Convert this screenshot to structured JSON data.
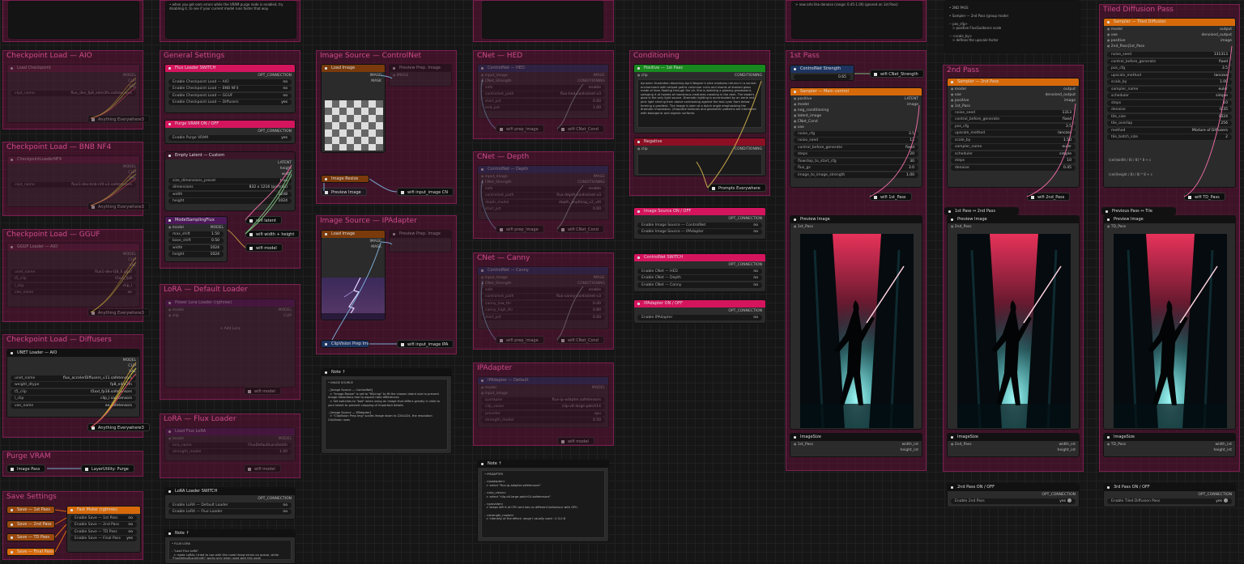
{
  "groups": {
    "ckpt_aio": "Checkpoint Load — AIO",
    "ckpt_nf4": "Checkpoint Load — BNB NF4",
    "ckpt_gguf": "Checkpoint Load — GGUF",
    "ckpt_diff": "Checkpoint Load — Diffusers",
    "purge": "Purge VRAM",
    "save": "Save Settings",
    "general": "General Settings",
    "lora_def": "LoRA — Default Loader",
    "lora_flux": "LoRA — Flux Loader",
    "img_cn": "Image Source — ControlNet",
    "img_ipa": "Image Source — IPAdapter",
    "cnet_hed": "CNet — HED",
    "cnet_depth": "CNet — Depth",
    "cnet_canny": "CNet — Canny",
    "ipadapter": "IPAdapter",
    "conditioning": "Conditioning",
    "pass1": "1st Pass",
    "pass2": "2nd Pass",
    "tiled": "Tiled Diffusion Pass"
  },
  "nodes": {
    "load_ckpt": "Load Checkpoint",
    "ckpt_nf4": "CheckpointLoaderNF4",
    "gguf_loader": "GGUF Loader — AIO",
    "unet_loader": "UNET Loader — AIO",
    "image_pass": "Image Pass",
    "layerutility_purge": "LayerUtility: Purge",
    "save_1st": "Save — 1st Pass",
    "save_2nd": "Save — 2nd Pass",
    "save_td": "Save — TD Pass",
    "save_final": "Save — Final Pass",
    "fast_muter": "Fast Muter (rgthree)",
    "flux_loader_switch": "Flux Loader SWITCH",
    "purge_switch": "Purge VRAM ON / OFF",
    "empty_latent": "Empty Latent — Custom",
    "model_sampling": "ModelSamplingFlux",
    "power_lora": "Power Lora Loader (rgthree)",
    "load_flux_lora": "Load Flux LoRA",
    "lora_switch": "LoRA Loader SWITCH",
    "note": "Note ↑",
    "load_image": "Load Image",
    "preview_prep": "Preview Prep. Image",
    "image_resize": "Image Resize",
    "clipvision_prep": "ClipVision Prep Img.",
    "controlnet_hed": "ControlNet — HED",
    "controlnet_depth": "ControlNet — Depth",
    "controlnet_canny": "ControlNet — Canny",
    "ipadapter_default": "IPAdapter — Default",
    "positive_1st": "Positive — 1st Pass",
    "negative": "Negative",
    "img_src_switch": "Image Source ON / OFF",
    "controlnet_switch": "ControlNet SWITCH",
    "ipadapter_switch": "IPAdapter ON / OFF",
    "controlnet_strength": "ControlNet Strength",
    "sampler_main": "Sampler — Main control",
    "preview_image": "Preview Image",
    "image_size": "ImageSize",
    "sampler_2nd": "Sampler — 2nd Pass",
    "pass2_switch": "2nd Pass  ON / OFF",
    "prev_tile": "Previous Pass ↔ Tile",
    "sampler_tiled": "Sampler — Tiled Diffusion",
    "pass3_switch": "3rd Pass  ON / OFF",
    "pass_1_2": "1st Pass ↔ 2nd Pass"
  },
  "labels": {
    "anything_everywhere3": "Anything Everywhere3",
    "anything_everywhere": "Anything Everywhere",
    "model": "MODEL",
    "clip": "CLIP",
    "vae": "VAE",
    "opt_connection": "OPT_CONNECTION",
    "conditioning": "CONDITIONING",
    "latent": "LATENT",
    "width": "width",
    "height": "height",
    "wifi_latent": "wifi latent",
    "wifi_wh": "wifi width + height",
    "wifi_model": "wifi model",
    "wifi_prep_image": "wifi prep_image",
    "wifi_cnet_cond": "wifi CNet_Cond",
    "wifi_input_cn": "wifi input_image CN",
    "wifi_input_ipa": "wifi input_image IPA",
    "prompts_everywhere": "Prompts Everywhere",
    "wifi_cnet_strength": "wifi CNet_Strength",
    "wifi_1st": "wifi 1st_Pass",
    "wifi_2nd": "wifi 2nd_Pass",
    "wifi_td": "wifi TD_Pass",
    "pass1": "1st_Pass",
    "pass2": "2nd_Pass",
    "td_pass": "TD_Pass",
    "width_int": "width_int",
    "height_int": "height_int",
    "image": "image",
    "images": "IMAGE",
    "image_in": "image",
    "clip_in": "clip",
    "model_in": "model",
    "positive": "positive",
    "negative": "negative",
    "vae_in": "vae",
    "denoised_output": "denoised_output",
    "output": "output",
    "image_out": "IMAGE",
    "mask": "MASK",
    "clip_vision": "CLIP_VISION",
    "preview_image_link": "Preview Image",
    "cnet_strength": "CNet_Strength",
    "input_image": "input_image",
    "neg_cond": "neg_conditioning",
    "latent_image": "latent_image",
    "cnet_cond": "CNet_Cond"
  },
  "widgets": {
    "ckpt_name": "flux_dev_fp8_e4m3fn.safetensors",
    "unet_name": "flux_dev_fp8_e4m3fn.safetensors",
    "bnb_name": "flux1-dev-bnb-nf4-v2.safetensors",
    "gguf_name": "flux1-dev-Q8_0.gguf",
    "enable_aio": "Enable Checkpoint Load — AIO",
    "enable_nf4": "Enable Checkpoint Load — BNB NF4",
    "enable_gguf": "Enable Checkpoint Load — GGUF",
    "enable_diff": "Enable Checkpoint Load — Diffusers",
    "enable_purge": "Enable Purge VRAM",
    "size_preset": "size_dimensions_preset",
    "size_val": "832 x 1216 (portrait)",
    "dimensions": "dimensions",
    "w": "1248",
    "h": "1024",
    "max_shift": "max_shift",
    "max_shift_v": "1.50",
    "base_shift": "base_shift",
    "base_shift_v": "0.50",
    "width": "width",
    "width_v": "1024",
    "height": "height",
    "height_v": "1024",
    "no": "no",
    "yes": "yes",
    "true": "true",
    "unet_name_l": "unet_name",
    "unet_val": "flux_accelerDiffusers_v11.safetensors",
    "weight_dtype": "weight_dtype",
    "weight_val": "fp8_e4m3fn",
    "clip1": "t5_clip",
    "clip1_v": "t5xxl_fp16.safetensors",
    "clip2": "l_clip",
    "clip2_v": "clip_l.safetensors",
    "vae_name": "vae_name",
    "vae_v": "ae.safetensors",
    "enable_save_1st": "Enable Save — 1st Pass",
    "enable_save_2nd": "Enable Save — 2nd Pass",
    "enable_save_td": "Enable Save — TD Pass",
    "enable_save_final": "Enable Save — Final Pass",
    "enable_default_loader": "Enable LoRA — Default Loader",
    "enable_flux_loader": "Enable LoRA — Flux Loader",
    "enable_is_cn": "Enable Image Source — ControlNet",
    "enable_is_ipa": "Enable Image Source — IPAdapter",
    "enable_hed": "Enable CNet — HED",
    "enable_depth": "Enable CNet — Depth",
    "enable_canny": "Enable CNet — Canny",
    "enable_ipa": "Enable IPAdapter",
    "enable_2nd": "Enable 2nd Pass",
    "enable_tiled": "Enable Tiled Diffusion Pass",
    "strength_v": "0.65",
    "add_lora": "+ Add Lora"
  },
  "sampler1": [
    [
      "noise_cfg",
      "3.5"
    ],
    [
      "noise_seed",
      "12"
    ],
    [
      "control_before_generate",
      "fixed"
    ],
    [
      "steps",
      "20"
    ],
    [
      "flowstep_to_start_cfg",
      "30"
    ],
    [
      "flux_gs",
      "3.0"
    ],
    [
      "image_to_image_strength",
      "1.00"
    ]
  ],
  "sampler2": [
    [
      "noise_seed",
      "1313"
    ],
    [
      "control_before_generate",
      "fixed"
    ],
    [
      "pos_cfg",
      "3.5"
    ],
    [
      "upscale_method",
      "lanczos"
    ],
    [
      "scale_by",
      "1.50"
    ],
    [
      "sampler_name",
      "euler"
    ],
    [
      "scheduler",
      "simple"
    ],
    [
      "steps",
      "10"
    ],
    [
      "denoise",
      "0.45"
    ]
  ],
  "sampler3": [
    [
      "noise_seed",
      "131313"
    ],
    [
      "control_before_generate",
      "fixed"
    ],
    [
      "pos_cfg",
      "3.5"
    ],
    [
      "upscale_method",
      "lanczos"
    ],
    [
      "scale_by",
      "1.00"
    ],
    [
      "sampler_name",
      "euler"
    ],
    [
      "scheduler",
      "simple"
    ],
    [
      "steps",
      "10"
    ],
    [
      "denoise",
      "0.35"
    ],
    [
      "tile_size",
      "1024"
    ],
    [
      "tile_overlap",
      "256"
    ],
    [
      "method",
      "Mixture of Diffusers"
    ],
    [
      "tile_batch_size",
      "2"
    ]
  ],
  "prompt_text": "dynamic illustration depicting April Wegner's slice madness returns in a surreal environment with striped gothic columnar ruins and shards of stained glass made of lines floating through the air. She is wielding a glowing greatsword, swinging it at hordes of monstrous creatures crawling in the dark. The blade's glow is the only light source. Dramatic lighting is accentuated by an eerie red-pink light shining from above contrasting against the teal-cyan from below forming a gradient. The image is seen at a dutch angle emphasizing the dramatic impression. (Exquisite textures and geometric patterns are interlaced with bioorganic and organic surfaces.",
  "note_image": "• IMAGE SOURCE\n\n- [Image Source — ControlNet]\n  > \"Image Resize\" is set to \"fill/crop\" to fit the chosen latent size to prevent image distortions due to aspect ratio differences\n  > Set switches to \"bad\" when using an image that differs greatly in ratio to your latent to prevent cropping of important details\n\n- [Image Source — IPAdapter]\n  > \"ClipVision Prep Img\" scales image down to 224x224, the resolution ClipVision uses",
  "note_ipa": "• IPADAPTER\n\n- <ipadapter>\n  > select \"flux-ip-adapter.safetensors\"\n\n- <clip_vision>\n  > select \"clip-vit-large-patch14.safetensors\"\n\n- <provider>\n  > keeps left it at CPU and has no different behaviour with GPU\n\n- <strength_model>\n  > intensity of the effect; range I usually used : 0.3-0.8",
  "note_lora": "• FLUX LORA\n\n- \"Load Flux LoRA\"\n  > made LoRAs I tried to use with this node throw errors on queue, while \"FluxDefaultLoraSmith\" works only when used with this node\n  > But LoRAs to appear at its dropdown list they need to be in",
  "note_top2": "• 2ND PASS\n\n• Sampler — 2nd Pass (group mode)\n\n-- pos_cfg>\n   > positive FluxGuidance scale\n\n-- <scale_by>\n   > defines the upscale factor",
  "note_top1": "• when you get oom errors while the VRAM purge node is enabled, try disabling it, to see if your current model runs faster that way.",
  "note_topright": "> new arts like denoise (range: 0.45-1.00) ignored on 1st Pass)"
}
